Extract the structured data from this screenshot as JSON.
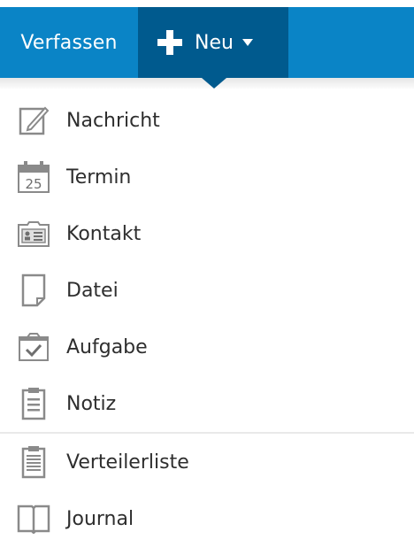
{
  "topbar": {
    "compose_label": "Verfassen",
    "new_label": "Neu"
  },
  "menu": {
    "items": [
      {
        "label": "Nachricht",
        "icon": "compose-icon"
      },
      {
        "label": "Termin",
        "icon": "calendar-icon"
      },
      {
        "label": "Kontakt",
        "icon": "contact-card-icon"
      },
      {
        "label": "Datei",
        "icon": "file-icon"
      },
      {
        "label": "Aufgabe",
        "icon": "task-icon"
      },
      {
        "label": "Notiz",
        "icon": "note-icon"
      },
      {
        "label": "Verteilerliste",
        "icon": "distribution-list-icon"
      },
      {
        "label": "Journal",
        "icon": "journal-icon"
      }
    ]
  },
  "colors": {
    "topbar_blue": "#0a84c6",
    "new_button_dark": "#005a8e",
    "icon_gray": "#8a8a8a",
    "text": "#2e2e2e"
  },
  "calendar_day": "25"
}
